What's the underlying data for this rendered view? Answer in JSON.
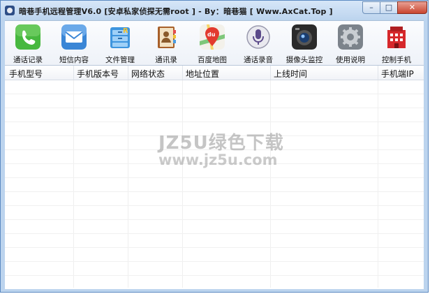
{
  "window": {
    "title": "暗巷手机远程管理V6.0 [安卓私家侦探无需root ]  - By：暗巷猫  [ Www.AxCat.Top ]",
    "minimize_glyph": "–",
    "maximize_glyph": "□",
    "close_glyph": "✕"
  },
  "toolbar": {
    "items": [
      {
        "label": "通话记录",
        "icon": "phone-icon",
        "color": "#3fae3a"
      },
      {
        "label": "短信内容",
        "icon": "envelope-icon",
        "color": "#3a86d6"
      },
      {
        "label": "文件管理",
        "icon": "file-cabinet-icon",
        "color": "#4aa3e8"
      },
      {
        "label": "通讯录",
        "icon": "contacts-book-icon",
        "color": "#b56a2a"
      },
      {
        "label": "百度地图",
        "icon": "map-pin-icon",
        "color": "#e23b2e"
      },
      {
        "label": "通话录音",
        "icon": "microphone-icon",
        "color": "#6d6d8a"
      },
      {
        "label": "摄像头监控",
        "icon": "camera-icon",
        "color": "#222222"
      },
      {
        "label": "使用说明",
        "icon": "gear-icon",
        "color": "#8a8f96"
      },
      {
        "label": "控制手机",
        "icon": "building-icon",
        "color": "#d6282b"
      }
    ]
  },
  "table": {
    "columns": [
      "手机型号",
      "手机版本号",
      "网络状态",
      "地址位置",
      "上线时间",
      "手机端IP"
    ],
    "rows": []
  },
  "watermark": {
    "line1": "JZ5U绿色下载",
    "line2": "www.jz5u.com"
  }
}
